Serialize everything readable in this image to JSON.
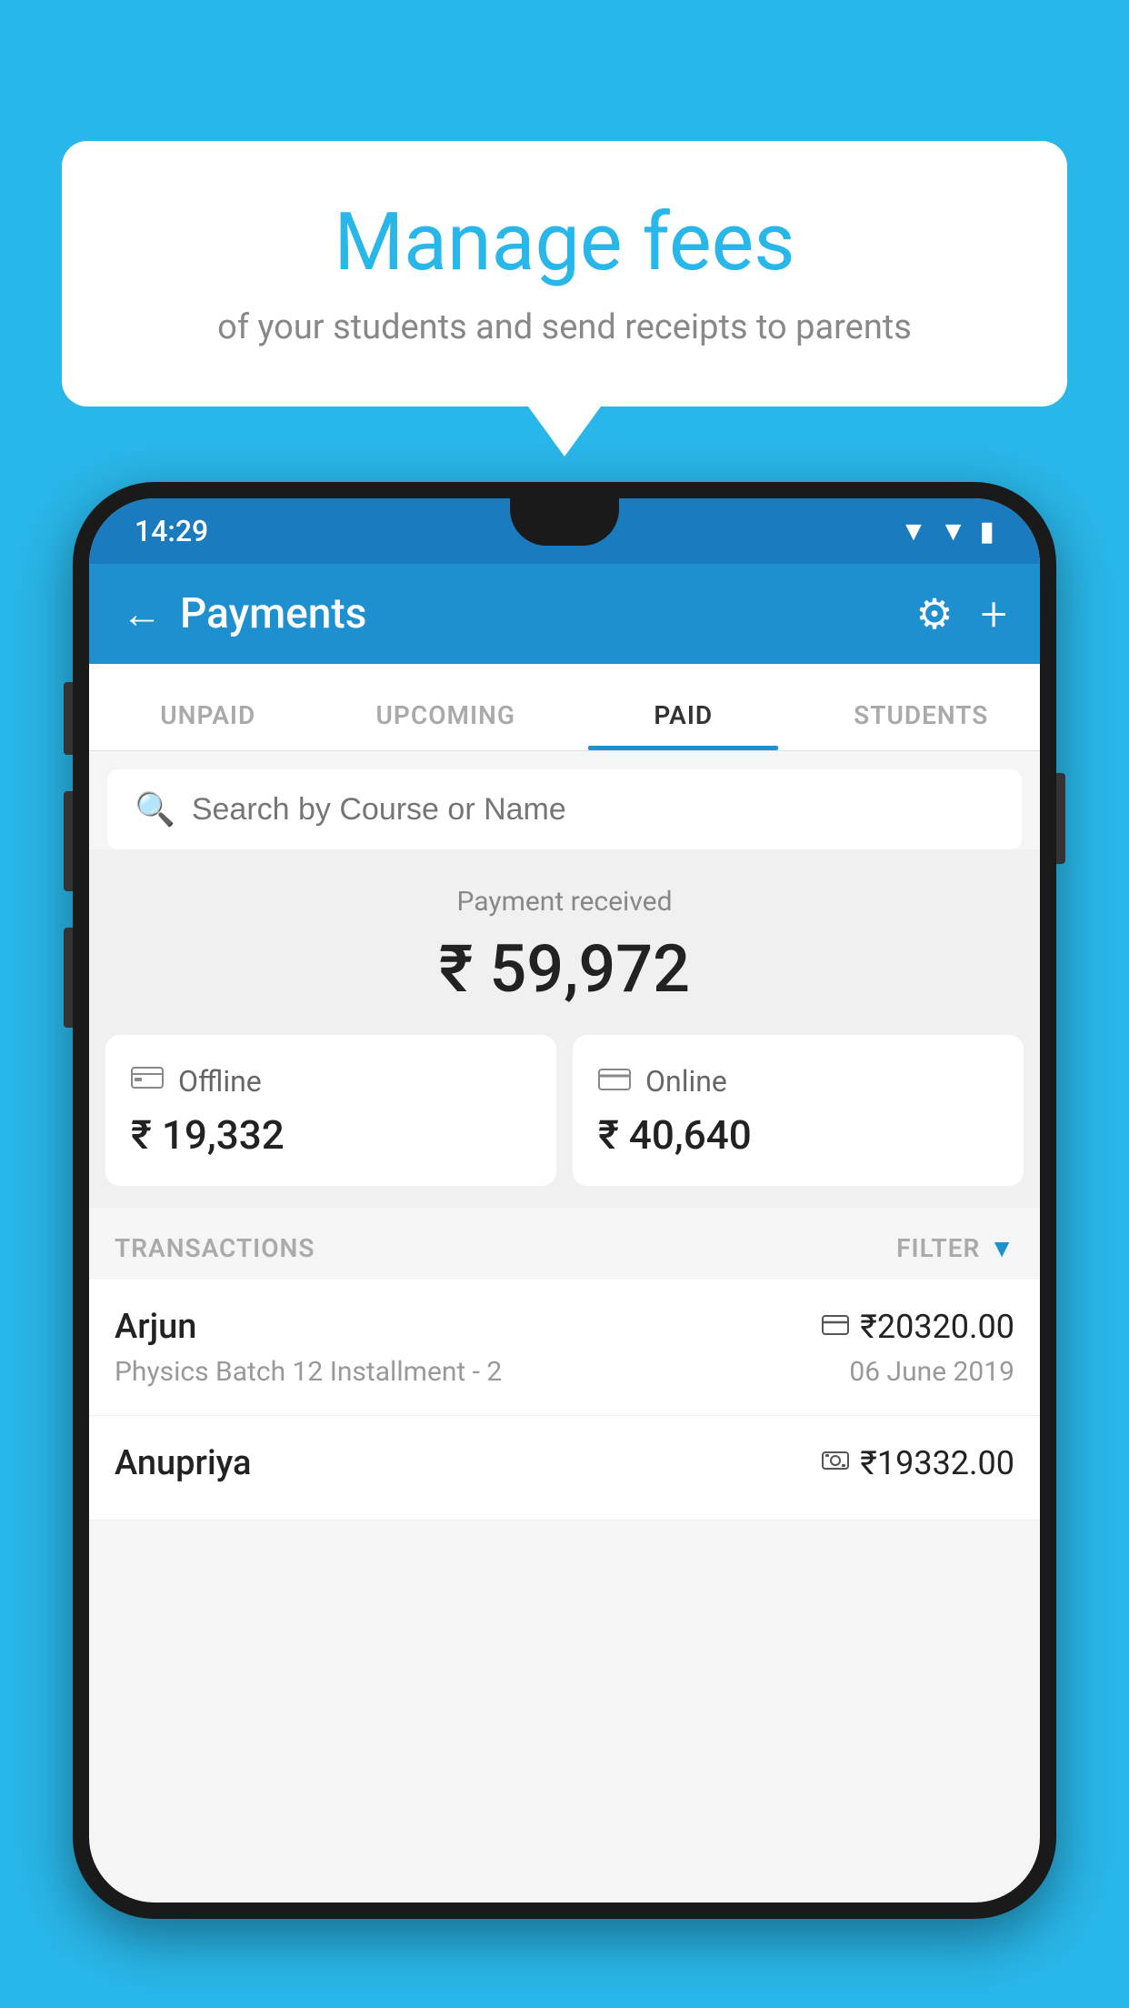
{
  "background_color": "#29b6e8",
  "speech_bubble": {
    "title": "Manage fees",
    "subtitle": "of your students and send receipts to parents"
  },
  "status_bar": {
    "time": "14:29",
    "wifi_icon": "▲",
    "signal_icon": "▲",
    "battery_icon": "▪"
  },
  "app_bar": {
    "title": "Payments",
    "back_label": "←",
    "settings_label": "⚙",
    "add_label": "+"
  },
  "tabs": [
    {
      "label": "UNPAID",
      "active": false
    },
    {
      "label": "UPCOMING",
      "active": false
    },
    {
      "label": "PAID",
      "active": true
    },
    {
      "label": "STUDENTS",
      "active": false
    }
  ],
  "search": {
    "placeholder": "Search by Course or Name"
  },
  "payment_summary": {
    "label": "Payment received",
    "amount": "₹ 59,972"
  },
  "payment_cards": [
    {
      "icon": "💳",
      "label": "Offline",
      "amount": "₹ 19,332"
    },
    {
      "icon": "💳",
      "label": "Online",
      "amount": "₹ 40,640"
    }
  ],
  "transactions_section": {
    "label": "TRANSACTIONS",
    "filter_label": "FILTER",
    "filter_icon": "▼"
  },
  "transactions": [
    {
      "name": "Arjun",
      "amount": "₹20320.00",
      "payment_mode_icon": "💳",
      "course": "Physics Batch 12 Installment - 2",
      "date": "06 June 2019"
    },
    {
      "name": "Anupriya",
      "amount": "₹19332.00",
      "payment_mode_icon": "💵",
      "course": "",
      "date": ""
    }
  ]
}
